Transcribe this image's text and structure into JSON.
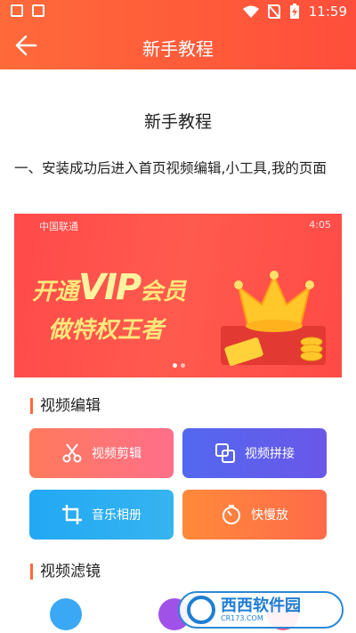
{
  "status_bar": {
    "time": "11:59",
    "icons": [
      "image-icon",
      "text-a-icon",
      "wifi-icon",
      "no-sim-icon",
      "battery-charging-icon"
    ]
  },
  "app_bar": {
    "title": "新手教程",
    "back_icon": "arrow-left-icon"
  },
  "content": {
    "heading": "新手教程",
    "step1": "一、安装成功后进入首页视频编辑,小工具,我的页面"
  },
  "screenshot": {
    "carrier": "中国联通",
    "time": "4:05",
    "banner_line1_a": "开通",
    "banner_vip": "VIP",
    "banner_line1_b": "会员",
    "banner_line2": "做特权王者"
  },
  "sections": {
    "video_edit": "视频编辑",
    "video_filter": "视频滤镜"
  },
  "buttons": [
    {
      "label": "视频剪辑",
      "icon": "scissors-icon"
    },
    {
      "label": "视频拼接",
      "icon": "merge-icon"
    },
    {
      "label": "音乐相册",
      "icon": "crop-icon"
    },
    {
      "label": "快慢放",
      "icon": "timer-icon"
    }
  ],
  "watermark": {
    "text": "西西软件园",
    "url": "CR173.COM"
  },
  "colors": {
    "accent": "#ff6a3a",
    "btn1": "#ff7a5c",
    "btn2": "#5a5ff0",
    "btn3": "#2aa8f0",
    "btn4": "#ff7a3a"
  }
}
